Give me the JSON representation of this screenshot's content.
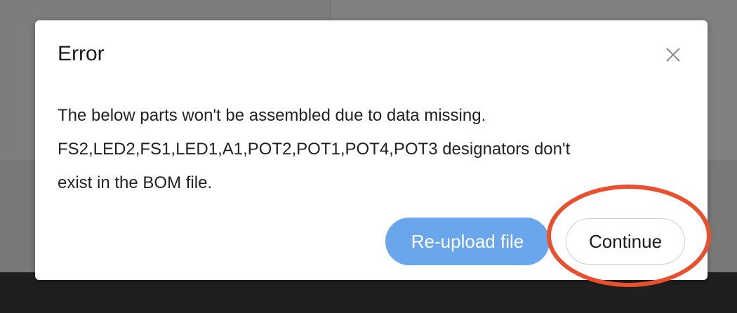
{
  "dialog": {
    "title": "Error",
    "close_icon": "close-icon",
    "message_line1": "The below parts won't be assembled due to data missing.",
    "message_line2": "FS2,LED2,FS1,LED1,A1,POT2,POT1,POT4,POT3 designators don't",
    "message_line3": "exist in the BOM file.",
    "reupload_label": "Re-upload file",
    "continue_label": "Continue"
  },
  "colors": {
    "primary_button": "#6aa6ec",
    "highlight_ring": "#e8502e"
  }
}
